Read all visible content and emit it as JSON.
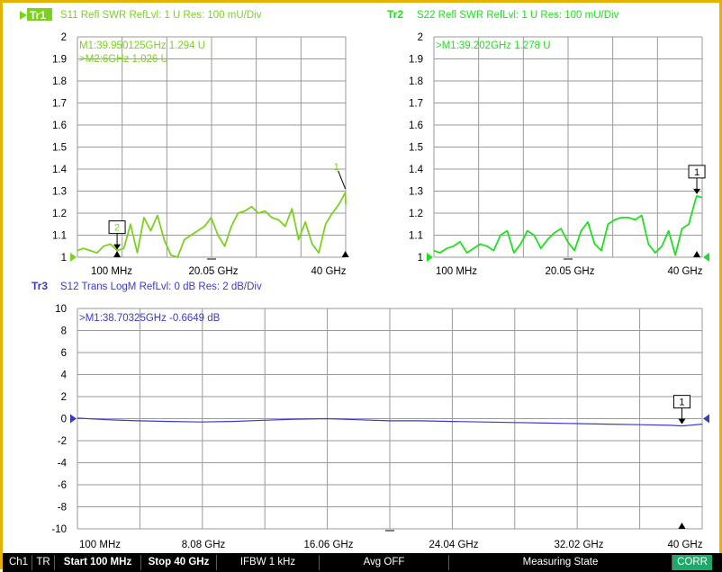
{
  "traces": [
    {
      "id": "tr1",
      "label": "Tr1",
      "header": "S11 Refl SWR RefLvl: 1  U Res: 100 mU/Div",
      "color": "#7ad21e",
      "y_ticks": [
        "2",
        "1.9",
        "1.8",
        "1.7",
        "1.6",
        "1.5",
        "1.4",
        "1.3",
        "1.2",
        "1.1",
        "1"
      ],
      "x_labels": [
        "100 MHz",
        "20.05 GHz",
        "40 GHz"
      ],
      "marker_readouts": [
        "M1:39.950125GHz  1.294  U",
        ">M2:6GHz  1.026  U"
      ],
      "markers": [
        {
          "label": "1",
          "x_ghz": 39.95,
          "y": 1.294,
          "boxed": false
        },
        {
          "label": "2",
          "x_ghz": 6.0,
          "y": 1.026,
          "boxed": true
        }
      ]
    },
    {
      "id": "tr2",
      "label": "Tr2",
      "header": "S22 Refl SWR RefLvl: 1  U Res: 100 mU/Div",
      "color": "#1fe01f",
      "y_ticks": [
        "2",
        "1.9",
        "1.8",
        "1.7",
        "1.6",
        "1.5",
        "1.4",
        "1.3",
        "1.2",
        "1.1",
        "1"
      ],
      "x_labels": [
        "100 MHz",
        "20.05 GHz",
        "40 GHz"
      ],
      "marker_readouts": [
        ">M1:39.202GHz  1.278  U"
      ],
      "markers": [
        {
          "label": "1",
          "x_ghz": 39.202,
          "y": 1.278,
          "boxed": true
        }
      ]
    },
    {
      "id": "tr3",
      "label": "Tr3",
      "header": "S12 Trans LogM RefLvl: 0  dB Res: 2  dB/Div",
      "color": "#3a3ac8",
      "y_ticks": [
        "10",
        "8",
        "6",
        "4",
        "2",
        "0",
        "-2",
        "-4",
        "-6",
        "-8",
        "-10"
      ],
      "x_labels": [
        "100 MHz",
        "8.08 GHz",
        "16.06 GHz",
        "24.04 GHz",
        "32.02 GHz",
        "40 GHz"
      ],
      "marker_readouts": [
        ">M1:38.70325GHz  -0.6649  dB"
      ],
      "markers": [
        {
          "label": "1",
          "x_ghz": 38.70325,
          "y": -0.6649,
          "boxed": true
        }
      ]
    }
  ],
  "status_bar": {
    "channel": "Ch1",
    "mode": "TR",
    "start": "Start 100 MHz",
    "stop": "Stop 40 GHz",
    "ifbw": "IFBW 1 kHz",
    "avg": "Avg OFF",
    "state": "Measuring State",
    "corr": "CORR"
  },
  "colors": {
    "frame": "#e4b300",
    "status_bg": "#000000",
    "corr_bg": "#1ea96a",
    "grid": "#9a9a9a"
  },
  "chart_data": [
    {
      "type": "line",
      "title": "S11 Refl SWR RefLvl: 1  U Res: 100 mU/Div",
      "xlabel": "",
      "ylabel": "",
      "xlim_ghz": [
        0.1,
        40
      ],
      "ylim": [
        1,
        2
      ],
      "series": [
        {
          "name": "Tr1",
          "x": [
            0.1,
            1,
            2,
            3,
            4,
            5,
            6,
            7,
            8,
            9,
            10,
            11,
            12,
            13,
            14,
            15,
            16,
            17,
            18,
            19,
            20,
            21,
            22,
            23,
            24,
            25,
            26,
            27,
            28,
            29,
            30,
            31,
            32,
            33,
            34,
            35,
            36,
            37,
            38,
            39,
            39.95,
            40
          ],
          "y": [
            1.03,
            1.04,
            1.03,
            1.02,
            1.05,
            1.06,
            1.03,
            1.04,
            1.15,
            1.02,
            1.18,
            1.12,
            1.19,
            1.08,
            1.01,
            1.0,
            1.08,
            1.1,
            1.12,
            1.14,
            1.18,
            1.1,
            1.05,
            1.14,
            1.2,
            1.21,
            1.23,
            1.2,
            1.21,
            1.18,
            1.17,
            1.14,
            1.22,
            1.08,
            1.16,
            1.06,
            1.02,
            1.15,
            1.2,
            1.24,
            1.294,
            1.24
          ]
        }
      ]
    },
    {
      "type": "line",
      "title": "S22 Refl SWR RefLvl: 1  U Res: 100 mU/Div",
      "xlabel": "",
      "ylabel": "",
      "xlim_ghz": [
        0.1,
        40
      ],
      "ylim": [
        1,
        2
      ],
      "series": [
        {
          "name": "Tr2",
          "x": [
            0.1,
            1,
            2,
            3,
            4,
            5,
            6,
            7,
            8,
            9,
            10,
            11,
            12,
            13,
            14,
            15,
            16,
            17,
            18,
            19,
            20,
            21,
            22,
            23,
            24,
            25,
            26,
            27,
            28,
            29,
            30,
            31,
            32,
            33,
            34,
            35,
            36,
            37,
            38,
            39,
            39.202,
            40
          ],
          "y": [
            1.03,
            1.02,
            1.04,
            1.05,
            1.07,
            1.02,
            1.04,
            1.06,
            1.05,
            1.03,
            1.1,
            1.12,
            1.02,
            1.06,
            1.12,
            1.1,
            1.04,
            1.08,
            1.11,
            1.13,
            1.07,
            1.03,
            1.12,
            1.16,
            1.06,
            1.03,
            1.15,
            1.17,
            1.18,
            1.18,
            1.17,
            1.19,
            1.06,
            1.02,
            1.05,
            1.12,
            1.01,
            1.13,
            1.15,
            1.26,
            1.278,
            1.27
          ]
        }
      ]
    },
    {
      "type": "line",
      "title": "S12 Trans LogM RefLvl: 0  dB Res: 2  dB/Div",
      "xlabel": "",
      "ylabel": "",
      "xlim_ghz": [
        0.1,
        40
      ],
      "ylim": [
        -10,
        10
      ],
      "series": [
        {
          "name": "Tr3",
          "x": [
            0.1,
            2,
            4,
            6,
            8,
            10,
            12,
            14,
            16,
            18,
            20,
            22,
            24,
            26,
            28,
            30,
            32,
            34,
            36,
            38,
            38.70325,
            40
          ],
          "y": [
            0.05,
            -0.1,
            -0.2,
            -0.25,
            -0.3,
            -0.25,
            -0.15,
            -0.05,
            0.0,
            -0.1,
            -0.2,
            -0.2,
            -0.25,
            -0.3,
            -0.35,
            -0.4,
            -0.45,
            -0.5,
            -0.55,
            -0.6,
            -0.6649,
            -0.5
          ]
        }
      ]
    }
  ]
}
